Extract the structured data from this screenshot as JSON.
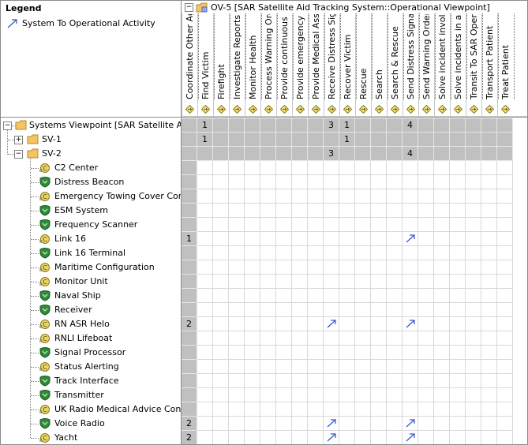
{
  "legend": {
    "title": "Legend",
    "item_label": "System To Operational Activity",
    "arrow_color": "#3355cc"
  },
  "header": {
    "title": "OV-5 [SAR Satellite Aid Tracking System::Operational Viewpoint]",
    "columns": [
      "Coordinate Other Ager",
      "Find Victim",
      "Firefight",
      "Investigate Reports Of",
      "Monitor Health",
      "Process Warning Order",
      "Provide continuous rad",
      "Provide emergency tov",
      "Provide Medical Assista",
      "Receive Distress Signal",
      "Recover Victim",
      "Rescue",
      "Search",
      "Search & Rescue",
      "Send Distress Signal",
      "Send Warning Order",
      "Solve incident involving",
      "Solve incidents in all ar",
      "Transit To SAR Operati",
      "Transport Patient",
      "Treat Patient"
    ]
  },
  "tree": {
    "root": {
      "label": "Systems Viewpoint [SAR Satellite Aid Tra",
      "expander": "-"
    },
    "packages": [
      {
        "label": "SV-1",
        "expander": "+"
      },
      {
        "label": "SV-2",
        "expander": "-"
      }
    ],
    "items": [
      {
        "label": "C2 Center",
        "icon": "component-icon",
        "count": ""
      },
      {
        "label": "Distress Beacon",
        "icon": "shield-icon",
        "count": ""
      },
      {
        "label": "Emergency Towing Cover Configu",
        "icon": "component-icon",
        "count": ""
      },
      {
        "label": "ESM System",
        "icon": "shield-icon",
        "count": ""
      },
      {
        "label": "Frequency Scanner",
        "icon": "shield-icon",
        "count": ""
      },
      {
        "label": "Link 16",
        "icon": "component-icon",
        "count": "1"
      },
      {
        "label": "Link 16 Terminal",
        "icon": "shield-icon",
        "count": ""
      },
      {
        "label": "Maritime Configuration",
        "icon": "component-icon",
        "count": ""
      },
      {
        "label": "Monitor Unit",
        "icon": "component-icon",
        "count": ""
      },
      {
        "label": "Naval Ship",
        "icon": "shield-icon",
        "count": ""
      },
      {
        "label": "Receiver",
        "icon": "shield-icon",
        "count": ""
      },
      {
        "label": "RN ASR Helo",
        "icon": "component-icon",
        "count": "2"
      },
      {
        "label": "RNLI Lifeboat",
        "icon": "component-icon",
        "count": ""
      },
      {
        "label": "Signal Processor",
        "icon": "shield-icon",
        "count": ""
      },
      {
        "label": "Status Alerting",
        "icon": "component-icon",
        "count": ""
      },
      {
        "label": "Track Interface",
        "icon": "shield-icon",
        "count": ""
      },
      {
        "label": "Transmitter",
        "icon": "shield-icon",
        "count": ""
      },
      {
        "label": "UK Radio Medical Advice Configur",
        "icon": "component-icon",
        "count": ""
      },
      {
        "label": "Voice Radio",
        "icon": "shield-icon",
        "count": "2"
      },
      {
        "label": "Yacht",
        "icon": "component-icon",
        "count": "2"
      }
    ]
  },
  "matrix": {
    "root_counts": {
      "Find Victim": "1",
      "Receive Distress Signal": "3",
      "Recover Victim": "1",
      "Send Distress Signal": "4"
    },
    "sv1_counts": {
      "Find Victim": "1",
      "Recover Victim": "1"
    },
    "sv2_counts": {
      "Receive Distress Signal": "3",
      "Send Distress Signal": "4"
    },
    "relations": [
      {
        "row": "Link 16",
        "columns": [
          "Send Distress Signal"
        ]
      },
      {
        "row": "RN ASR Helo",
        "columns": [
          "Receive Distress Signal",
          "Send Distress Signal"
        ]
      },
      {
        "row": "Voice Radio",
        "columns": [
          "Receive Distress Signal",
          "Send Distress Signal"
        ]
      },
      {
        "row": "Yacht",
        "columns": [
          "Receive Distress Signal",
          "Send Distress Signal"
        ]
      }
    ]
  }
}
